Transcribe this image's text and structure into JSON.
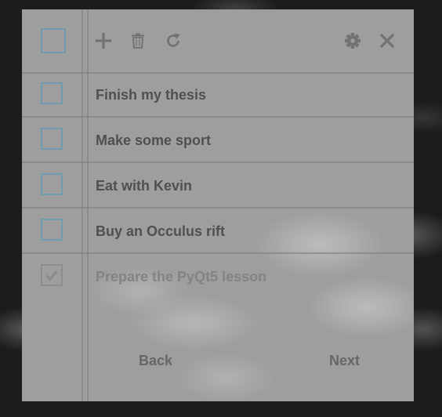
{
  "toolbar": {
    "icons": [
      "add-icon",
      "trash-icon",
      "refresh-icon",
      "gear-icon",
      "close-icon"
    ]
  },
  "tasks": [
    {
      "label": "Finish my thesis",
      "done": false
    },
    {
      "label": "Make some sport",
      "done": false
    },
    {
      "label": "Eat with Kevin",
      "done": false
    },
    {
      "label": "Buy an Occulus rift",
      "done": false
    },
    {
      "label": "Prepare the PyQt5 lesson",
      "done": true
    }
  ],
  "navigation": {
    "back_label": "Back",
    "next_label": "Next"
  },
  "colors": {
    "checkbox_border": "#6f9bb0",
    "text": "#505050",
    "done_text": "#838383",
    "icon": "#727272"
  }
}
